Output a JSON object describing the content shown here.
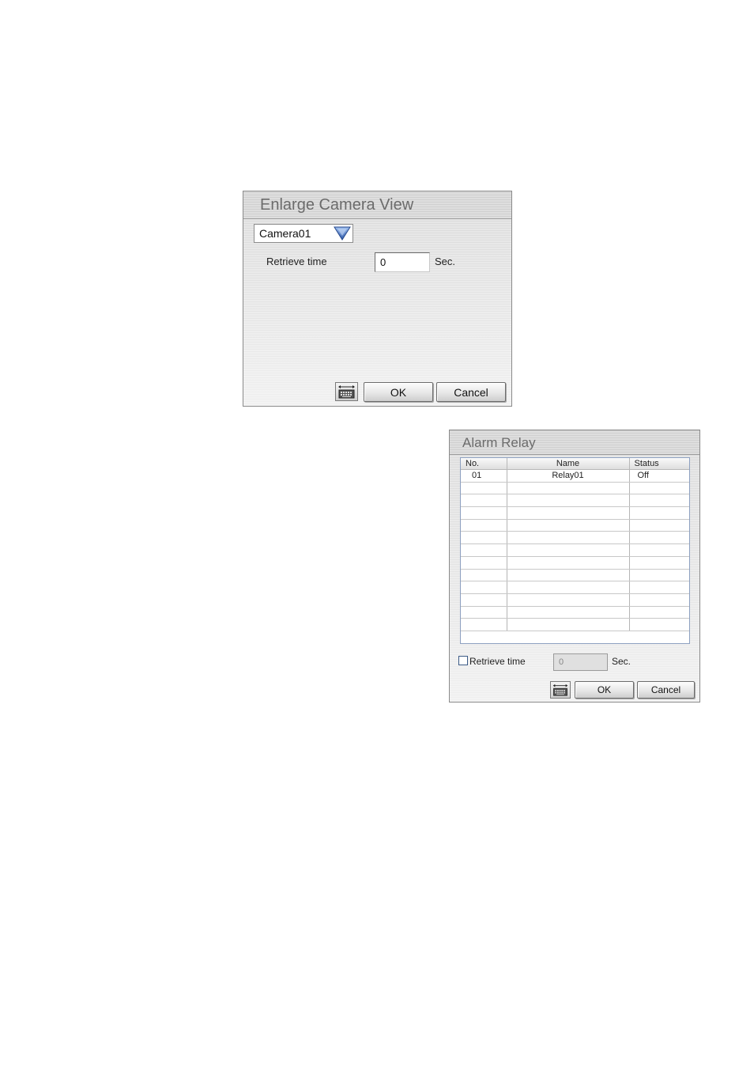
{
  "enlarge_dialog": {
    "title": "Enlarge Camera View",
    "camera_select": {
      "value": "Camera01"
    },
    "retrieve_label": "Retrieve time",
    "retrieve_value": "0",
    "unit": "Sec.",
    "ok_label": "OK",
    "cancel_label": "Cancel"
  },
  "alarm_dialog": {
    "title": "Alarm Relay",
    "columns": [
      "No.",
      "Name",
      "Status"
    ],
    "rows": [
      {
        "no": "01",
        "name": "Relay01",
        "status": "Off"
      }
    ],
    "retrieve_label": "Retrieve time",
    "retrieve_value": "0",
    "retrieve_checked": false,
    "unit": "Sec.",
    "ok_label": "OK",
    "cancel_label": "Cancel"
  },
  "colors": {
    "dropdown_arrow": "#3c67b8",
    "grid_border": "#8da0c0",
    "checkbox_border": "#3b5a86"
  }
}
